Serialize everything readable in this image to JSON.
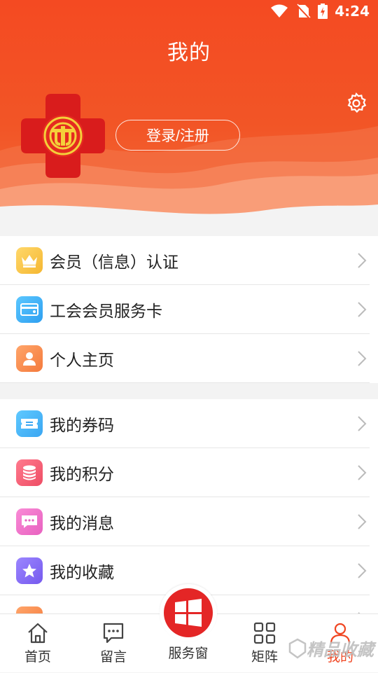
{
  "status": {
    "time": "4:24"
  },
  "header": {
    "title": "我的",
    "login_label": "登录/注册"
  },
  "colors": {
    "accent": "#f04521",
    "header": "#f44a22"
  },
  "menu_group1": [
    {
      "label": "会员（信息）认证",
      "icon": "crown-icon"
    },
    {
      "label": "工会会员服务卡",
      "icon": "card-icon"
    },
    {
      "label": "个人主页",
      "icon": "person-icon"
    }
  ],
  "menu_group2": [
    {
      "label": "我的券码",
      "icon": "ticket-icon"
    },
    {
      "label": "我的积分",
      "icon": "coins-icon"
    },
    {
      "label": "我的消息",
      "icon": "message-icon"
    },
    {
      "label": "我的收藏",
      "icon": "star-icon"
    },
    {
      "label": "",
      "icon": "document-icon"
    }
  ],
  "bottom_nav": {
    "home": "首页",
    "message": "留言",
    "service": "服务窗",
    "matrix": "矩阵",
    "mine": "我的"
  },
  "watermark": "精品收藏"
}
